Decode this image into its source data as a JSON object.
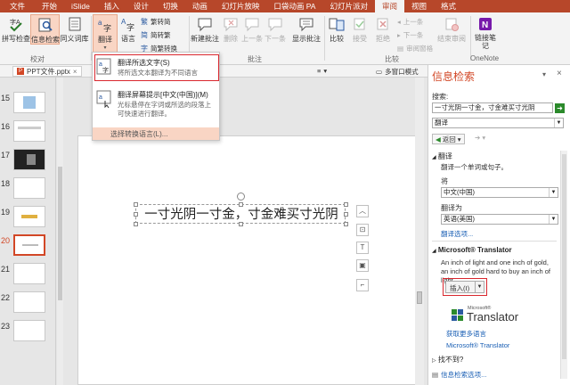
{
  "tabs": [
    "文件",
    "开始",
    "iSlide",
    "插入",
    "设计",
    "切换",
    "动画",
    "幻灯片放映",
    "口袋动画 PA",
    "幻灯片派对",
    "审阅",
    "视图",
    "格式"
  ],
  "ribbon": {
    "spell_check": "拼写检查",
    "research": "信息检索",
    "thesaurus": "同义词库",
    "translate": "翻译",
    "language": "语言",
    "to_traditional": "繁转简",
    "to_simplified": "简转繁",
    "simp_trad_convert": "简繁转换",
    "new_comment": "新建批注",
    "delete": "删除",
    "previous": "上一条",
    "next": "下一条",
    "show_comments": "显示批注",
    "compare": "比较",
    "accept": "接受",
    "reject": "拒绝",
    "prev_small": "上一条",
    "next_small": "下一条",
    "reviewing_pane": "审阅窗格",
    "end_review": "结束审阅",
    "link_notes": "链接笔记",
    "group_proofing": "校对",
    "group_comments": "批注",
    "group_compare": "比较",
    "group_onenote": "OneNote"
  },
  "dropdown": {
    "item1_title": "翻译所选文字(S)",
    "item1_desc": "将所选文本翻译为不同语言",
    "item2_title": "翻译屏幕提示[中文(中国)](M)",
    "item2_desc": "光标悬停在字词或所选的段落上可快速进行翻译。",
    "item3_title": "选择转换语言(L)..."
  },
  "docbar": {
    "file_tab": "PPT文件.pptx",
    "close": "×",
    "multi_window": "多窗口模式"
  },
  "slides": {
    "numbers": [
      "15",
      "16",
      "17",
      "18",
      "19",
      "20",
      "21",
      "22",
      "23"
    ],
    "selected": "20"
  },
  "slide_text": "一寸光阴一寸金，寸金难买寸光阴",
  "panel": {
    "title": "信息检索",
    "search_label": "搜索:",
    "search_value": "一寸光阴一寸金，寸金难买寸光阴",
    "source": "翻译",
    "back": "返回",
    "section_translate": "翻译",
    "translate_desc": "翻译一个单词或句子。",
    "from_label": "将",
    "from_value": "中文(中国)",
    "to_label": "翻译为",
    "to_value": "英语(美国)",
    "options_link": "翻译选项...",
    "section_ms": "Microsoft® Translator",
    "translation": "An inch of light and one inch of gold, an inch of gold hard to buy an inch of light",
    "insert": "插入(I)",
    "logo_small": "Microsoft®",
    "logo_big": "Translator",
    "more_languages": "获取更多语言",
    "ms_link": "Microsoft® Translator",
    "not_found": "找不到?",
    "research_options": "信息检索选项..."
  },
  "colors": {
    "accent": "#b7472a",
    "panel_title": "#d24726",
    "highlight_box": "#d9272e",
    "link": "#1a5fb4"
  }
}
